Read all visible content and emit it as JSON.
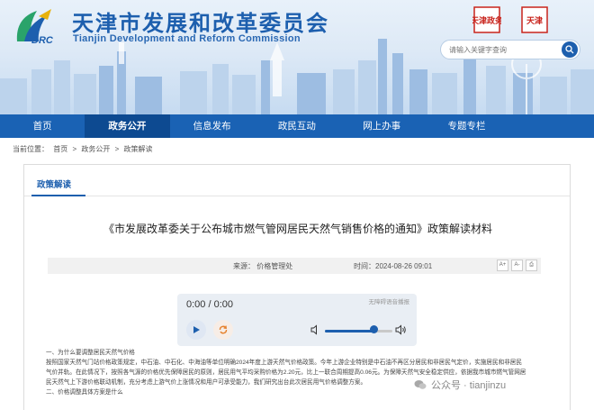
{
  "site": {
    "title": "天津市发展和改革委员会",
    "subtitle": "Tianjin Development and Reform Commission",
    "logo_text": "DRC",
    "seal_1": "天津政务",
    "seal_2": "天津"
  },
  "search": {
    "placeholder": "请输入关键字查询"
  },
  "nav": {
    "items": [
      {
        "label": "首页"
      },
      {
        "label": "政务公开"
      },
      {
        "label": "信息发布"
      },
      {
        "label": "政民互动"
      },
      {
        "label": "网上办事"
      },
      {
        "label": "专题专栏"
      }
    ],
    "active_index": 1
  },
  "breadcrumb": {
    "prefix": "当前位置：",
    "items": [
      "首页",
      "政务公开",
      "政策解读"
    ],
    "separator": ">"
  },
  "panel": {
    "tab": "政策解读"
  },
  "article": {
    "title": "《市发展改革委关于公布城市燃气管网居民天然气销售价格的通知》政策解读材料",
    "source": "来源：  价格管理处",
    "time": "时间：2024-08-26 09:01",
    "tools": [
      "A+",
      "A-",
      "⎙"
    ]
  },
  "player": {
    "note": "无障碍语音播报",
    "time": "0:00 / 0:00",
    "volume_fraction": 0.72
  },
  "body": {
    "paragraphs": [
      "一、为什么要调整居民天然气价格",
      "按照国家天然气门站价格政策规定，中石油、中石化、中海油等单位明确2024年度上游天然气价格政策。今年上游企业特别是中石油不再区分居民和非居民气定价，实施居民和非居民",
      "气价并轨。在此情况下，按照各气源的价格优先保障居民的原则，居民用气平均采购价格为2.20元，比上一联合周期提高0.06元。为保障天然气安全稳定供应，依据我市城市燃气管网居",
      "民天然气上下游价格联动机制，充分考虑上游气价上涨情况和用户可承受能力，我们研究出台此次居民用气价格调整方案。",
      "二、价格调整具体方案是什么"
    ]
  },
  "watermark": {
    "text": "公众号 · tianjinzu"
  },
  "colors": {
    "brand": "#1d5fae",
    "nav": "#1a62b4",
    "nav_active": "#0d4a91"
  }
}
